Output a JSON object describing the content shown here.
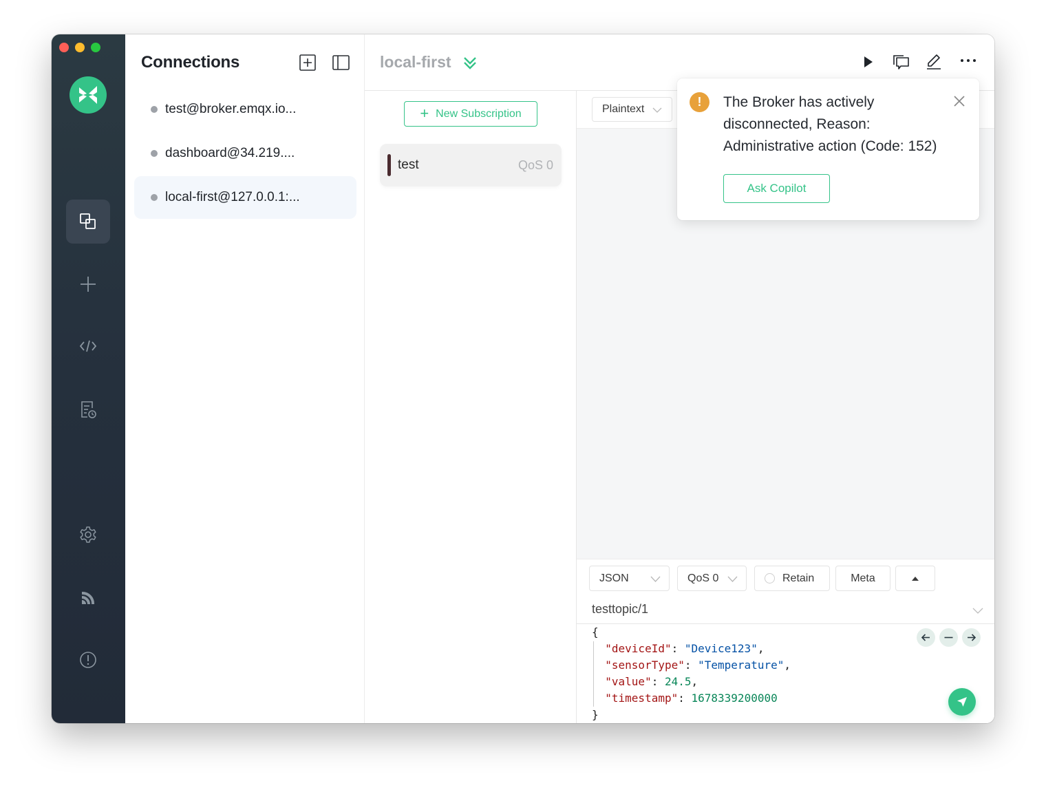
{
  "window": {
    "traffic_lights": [
      "close",
      "minimize",
      "zoom"
    ]
  },
  "rail": {
    "logo": "mqttx-logo",
    "items": [
      {
        "name": "connections",
        "icon": "connections-icon",
        "active": true
      },
      {
        "name": "new-connection",
        "icon": "plus-icon",
        "active": false
      },
      {
        "name": "script",
        "icon": "code-icon",
        "active": false
      },
      {
        "name": "log",
        "icon": "log-icon",
        "active": false
      },
      {
        "name": "settings",
        "icon": "gear-icon",
        "active": false
      },
      {
        "name": "subscribe-feed",
        "icon": "rss-icon",
        "active": false
      },
      {
        "name": "about",
        "icon": "info-icon",
        "active": false
      }
    ]
  },
  "connections": {
    "title": "Connections",
    "items": [
      {
        "label": "test@broker.emqx.io...",
        "status": "disconnected",
        "active": false
      },
      {
        "label": "dashboard@34.219....",
        "status": "disconnected",
        "active": false
      },
      {
        "label": "local-first@127.0.0.1:...",
        "status": "disconnected",
        "active": true
      }
    ]
  },
  "header": {
    "title": "local-first",
    "actions": [
      "connect",
      "new-window",
      "edit",
      "more"
    ]
  },
  "subscriptions": {
    "new_button": "New Subscription",
    "items": [
      {
        "topic": "test",
        "qos": "QoS 0",
        "color": "#4a2b2f"
      }
    ]
  },
  "messages": {
    "payload_format": "Plaintext"
  },
  "publish": {
    "format": "JSON",
    "qos": "QoS 0",
    "retain_label": "Retain",
    "retain_checked": false,
    "meta_label": "Meta",
    "topic": "testtopic/1",
    "payload": {
      "open": "{",
      "close": "}",
      "fields": [
        {
          "key": "\"deviceId\"",
          "value": "\"Device123\"",
          "type": "string",
          "comma": true
        },
        {
          "key": "\"sensorType\"",
          "value": "\"Temperature\"",
          "type": "string",
          "comma": true
        },
        {
          "key": "\"value\"",
          "value": "24.5",
          "type": "number",
          "comma": true
        },
        {
          "key": "\"timestamp\"",
          "value": "1678339200000",
          "type": "number",
          "comma": false
        }
      ]
    }
  },
  "notification": {
    "level": "warning",
    "message": "The Broker has actively disconnected, Reason: Administrative action (Code: 152)",
    "action_label": "Ask Copilot"
  },
  "colors": {
    "accent": "#34c388",
    "warning": "#e8a13a",
    "rail_bg": "#25303d"
  }
}
